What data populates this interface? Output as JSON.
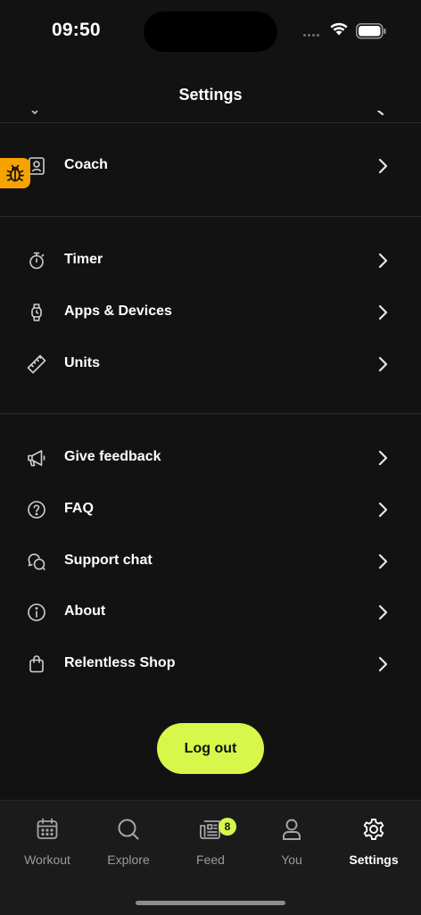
{
  "status_bar": {
    "time": "09:50"
  },
  "header": {
    "title": "Settings"
  },
  "sections": [
    {
      "items": [
        {
          "label": "Coach",
          "icon": "coach-icon"
        }
      ]
    },
    {
      "items": [
        {
          "label": "Timer",
          "icon": "stopwatch-icon"
        },
        {
          "label": "Apps & Devices",
          "icon": "watch-icon"
        },
        {
          "label": "Units",
          "icon": "ruler-icon"
        }
      ]
    },
    {
      "items": [
        {
          "label": "Give feedback",
          "icon": "megaphone-icon"
        },
        {
          "label": "FAQ",
          "icon": "question-circle-icon"
        },
        {
          "label": "Support chat",
          "icon": "chat-bubbles-icon"
        },
        {
          "label": "About",
          "icon": "info-circle-icon"
        },
        {
          "label": "Relentless Shop",
          "icon": "shopping-bag-icon"
        }
      ]
    }
  ],
  "logout_label": "Log out",
  "debug_badge_icon": "bug-icon",
  "tabbar": {
    "tabs": [
      {
        "label": "Workout",
        "icon": "calendar-icon",
        "active": false
      },
      {
        "label": "Explore",
        "icon": "search-icon",
        "active": false
      },
      {
        "label": "Feed",
        "icon": "newspaper-icon",
        "active": false,
        "badge": "8"
      },
      {
        "label": "You",
        "icon": "person-icon",
        "active": false
      },
      {
        "label": "Settings",
        "icon": "gear-icon",
        "active": true
      }
    ]
  },
  "colors": {
    "background": "#121212",
    "accent": "#d7f74a",
    "debug_tab": "#f6a300",
    "divider": "#2c2c2c",
    "inactive_tab": "#9a9a9a"
  }
}
